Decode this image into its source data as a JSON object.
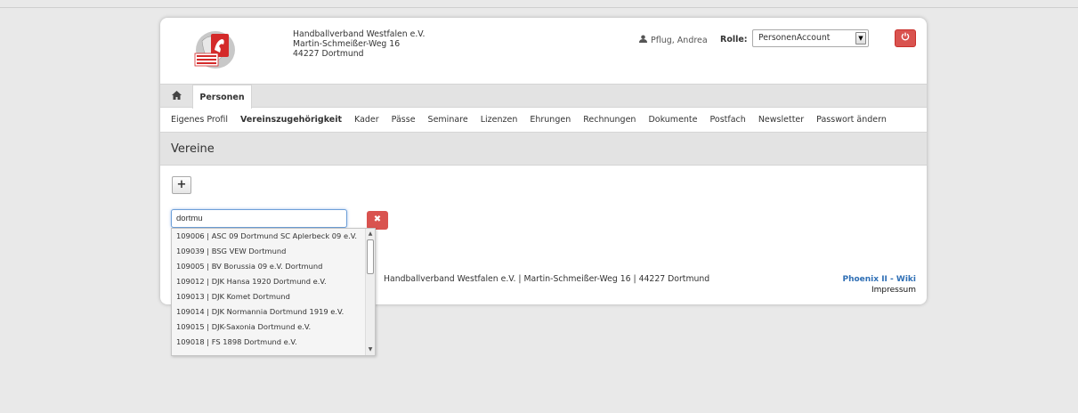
{
  "org": {
    "name": "Handballverband Westfalen e.V.",
    "street": "Martin-Schmeißer-Weg 16",
    "city": "44227 Dortmund",
    "logo_text": "HANDBALL VERBAND WESTFALEN"
  },
  "header": {
    "user": "Pflug, Andrea",
    "role_label": "Rolle:",
    "role_value": "PersonenAccount"
  },
  "tabs": {
    "active": "Personen"
  },
  "subnav": [
    "Eigenes Profil",
    "Vereinszugehörigkeit",
    "Kader",
    "Pässe",
    "Seminare",
    "Lizenzen",
    "Ehrungen",
    "Rechnungen",
    "Dokumente",
    "Postfach",
    "Newsletter",
    "Passwort ändern"
  ],
  "section": {
    "title": "Vereine"
  },
  "search": {
    "value": "dortmu"
  },
  "results": [
    "109006 | ASC 09 Dortmund SC Aplerbeck 09 e.V.",
    "109039 | BSG VEW Dortmund",
    "109005 | BV Borussia 09 e.V. Dortmund",
    "109012 | DJK Hansa 1920 Dortmund e.V.",
    "109013 | DJK Komet Dortmund",
    "109014 | DJK Normannia Dortmund 1919 e.V.",
    "109015 | DJK-Saxonia Dortmund e.V.",
    "109018 | FS 1898 Dortmund e.V."
  ],
  "footer": {
    "text": "Handballverband Westfalen e.V. | Martin-Schmeißer-Weg 16 | 44227 Dortmund",
    "wiki": "Phoenix II - Wiki",
    "imprint": "Impressum"
  },
  "icons": {
    "user": "user-icon",
    "home": "home-icon",
    "power": "power-icon",
    "plus": "plus-icon",
    "clear": "close-icon"
  },
  "colors": {
    "danger": "#d9534f",
    "link": "#2f6fb5",
    "panel": "#e3e3e3"
  }
}
